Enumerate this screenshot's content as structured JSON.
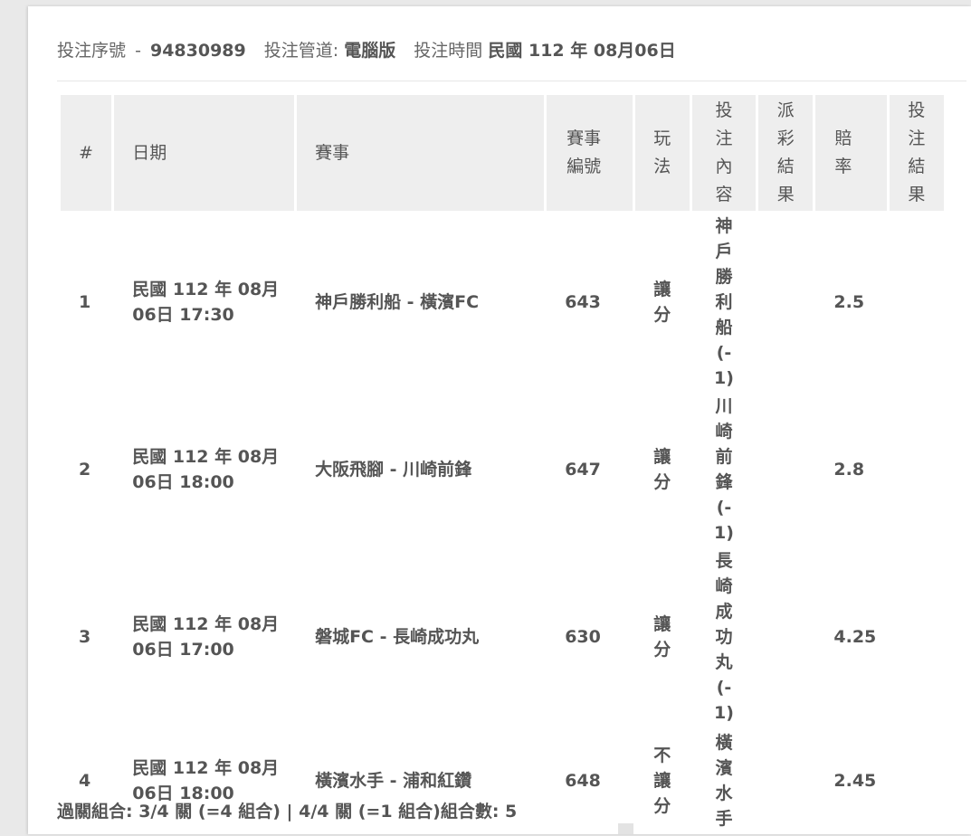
{
  "header": {
    "serial_label": "投注序號",
    "serial_sep": "-",
    "serial_value": "94830989",
    "channel_label": "投注管道:",
    "channel_value": "電腦版",
    "time_label": "投注時間",
    "time_value": "民國 112 年 08月06日"
  },
  "table": {
    "columns": [
      "#",
      "日期",
      "賽事",
      "賽事編號",
      "玩法",
      "投注內容",
      "派彩結果",
      "賠率",
      "投注結果"
    ],
    "rows": [
      {
        "no": "1",
        "date": "民國 112 年 08月 06日 17:30",
        "match": "神戶勝利船 - 橫濱FC",
        "match_id": "643",
        "play": "讓分",
        "bet": "神戶勝利船(-1)",
        "payout": "",
        "odds": "2.5",
        "result": ""
      },
      {
        "no": "2",
        "date": "民國 112 年 08月 06日 18:00",
        "match": "大阪飛腳 - 川崎前鋒",
        "match_id": "647",
        "play": "讓分",
        "bet": "川崎前鋒(-1)",
        "payout": "",
        "odds": "2.8",
        "result": ""
      },
      {
        "no": "3",
        "date": "民國 112 年 08月 06日 17:00",
        "match": "磐城FC - 長崎成功丸",
        "match_id": "630",
        "play": "讓分",
        "bet": "長崎成功丸(-1)",
        "payout": "",
        "odds": "4.25",
        "result": ""
      },
      {
        "no": "4",
        "date": "民國 112 年 08月 06日 18:00",
        "match": "橫濱水手 - 浦和紅鑽",
        "match_id": "648",
        "play": "不讓分",
        "bet": "橫濱水手",
        "payout": "",
        "odds": "2.45",
        "result": ""
      }
    ]
  },
  "footer": {
    "text": "過關組合: 3/4 關 (=4 組合) | 4/4 關 (=1 組合)組合數: 5"
  }
}
